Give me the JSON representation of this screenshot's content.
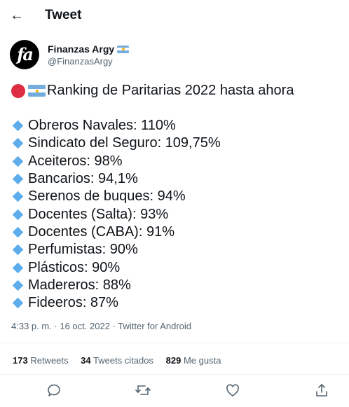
{
  "header": {
    "back_icon": "arrow-left-icon",
    "title": "Tweet"
  },
  "author": {
    "avatar_label": "fa",
    "name": "Finanzas Argy",
    "handle": "@FinanzasArgy"
  },
  "tweet": {
    "headline": "Ranking de Paritarias 2022 hasta ahora",
    "items": [
      "Obreros Navales: 110%",
      "Sindicato del Seguro: 109,75%",
      "Aceiteros: 98%",
      "Bancarios: 94,1%",
      "Serenos de buques: 94%",
      "Docentes (Salta): 93%",
      "Docentes (CABA): 91%",
      "Perfumistas: 90%",
      "Plásticos: 90%",
      "Madereros: 88%",
      "Fideeros: 87%"
    ],
    "timestamp": "4:33 p. m. · 16 oct. 2022 · Twitter for Android"
  },
  "stats": {
    "retweets_count": "173",
    "retweets_label": "Retweets",
    "quotes_count": "34",
    "quotes_label": "Tweets citados",
    "likes_count": "829",
    "likes_label": "Me gusta"
  },
  "actions": {
    "reply": "reply-icon",
    "retweet": "retweet-icon",
    "like": "heart-icon",
    "share": "share-icon"
  },
  "colors": {
    "text": "#0f1419",
    "secondary": "#536471",
    "accent_diamond": "#5dadec",
    "red_circle": "#dd2e44",
    "flag_blue": "#74acdf"
  }
}
